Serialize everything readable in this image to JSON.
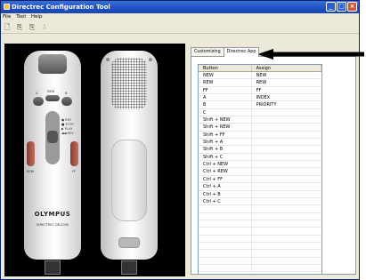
{
  "window": {
    "title": "Directrec Configuration Tool"
  },
  "menu": [
    "File",
    "Tool",
    "Help"
  ],
  "toolbar": [
    {
      "name": "new-icon",
      "glyph": "🗋"
    },
    {
      "name": "open-icon",
      "glyph": "⎘"
    },
    {
      "name": "save-icon",
      "glyph": "⎘"
    },
    {
      "name": "download-icon",
      "glyph": "⇩"
    }
  ],
  "device": {
    "front_buttons": {
      "a": "A",
      "new": "NEW",
      "b": "B",
      "rew": "REW",
      "ff": "FF"
    },
    "slider_labels": [
      "● REC",
      "■ STOP",
      "▶ PLAY",
      "◀◀ REV"
    ],
    "brand": "OLYMPUS",
    "model": "DIRECTREC DR-2000"
  },
  "tabs": [
    {
      "label": "Customizing",
      "active": false
    },
    {
      "label": "Directrec App",
      "active": true
    }
  ],
  "table": {
    "headers": [
      "Button",
      "Assign"
    ],
    "rows": [
      [
        "NEW",
        "NEW"
      ],
      [
        "REW",
        "REW"
      ],
      [
        "FF",
        "FF"
      ],
      [
        "A",
        "INDEX"
      ],
      [
        "B",
        "PRIORITY"
      ],
      [
        "C",
        ""
      ],
      [
        "Shift + NEW",
        ""
      ],
      [
        "Shift + REW",
        ""
      ],
      [
        "Shift + FF",
        ""
      ],
      [
        "Shift + A",
        ""
      ],
      [
        "Shift + B",
        ""
      ],
      [
        "Shift + C",
        ""
      ],
      [
        "Ctrl + NEW",
        ""
      ],
      [
        "Ctrl + REW",
        ""
      ],
      [
        "Ctrl + FF",
        ""
      ],
      [
        "Ctrl + A",
        ""
      ],
      [
        "Ctrl + B",
        ""
      ],
      [
        "Ctrl + C",
        ""
      ],
      [
        "",
        ""
      ],
      [
        "",
        ""
      ],
      [
        "",
        ""
      ],
      [
        "",
        ""
      ],
      [
        "",
        ""
      ],
      [
        "",
        ""
      ],
      [
        "",
        ""
      ],
      [
        "",
        ""
      ],
      [
        "",
        ""
      ]
    ]
  }
}
